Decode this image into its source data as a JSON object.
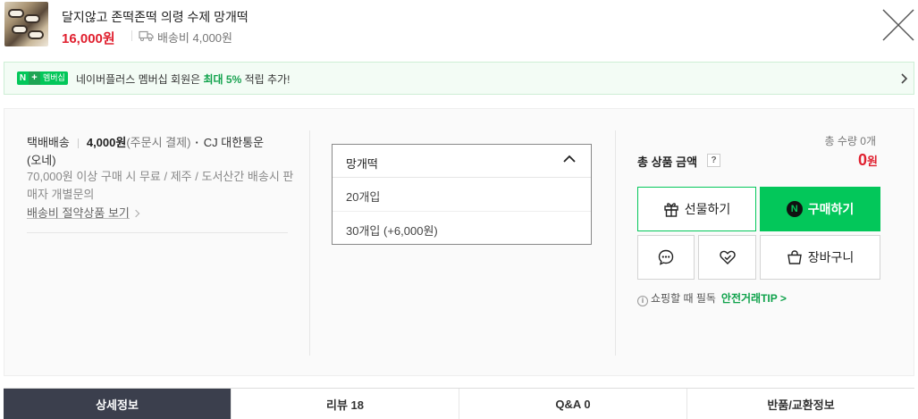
{
  "product": {
    "title": "달지않고 존떡존떡 의령 수제 망개떡",
    "price": "16,000원",
    "shipping_fee": "배송비 4,000원"
  },
  "banner": {
    "badge_n": "N",
    "badge_plus": "+",
    "badge_label": "멤버십",
    "text_prefix": "네이버플러스 멤버십 회원은 ",
    "text_highlight": "최대",
    "text_rate": "5%",
    "text_suffix": " 적립 추가!"
  },
  "shipping": {
    "method": "택배배송",
    "fee": "4,000원",
    "fee_condition": "(주문시 결제)",
    "carrier": "CJ 대한통운",
    "carrier_note": "(오네)",
    "note": "70,000원 이상 구매 시 무료 / 제주 / 도서산간 배송시 판매자 개별문의",
    "save_link": "배송비 절약상품 보기"
  },
  "option": {
    "selected": "망개떡",
    "options": [
      "20개입",
      "30개입 (+6,000원)"
    ]
  },
  "summary": {
    "total_qty": "총 수량 0개",
    "total_label": "총 상품 금액",
    "help_icon": "?",
    "total_price": "0",
    "total_unit": "원"
  },
  "buttons": {
    "gift": "선물하기",
    "buy": "구매하기",
    "buy_badge": "N",
    "cart": "장바구니"
  },
  "safe_trade": {
    "info_icon": "i",
    "text": "쇼핑할 때 필독",
    "tip": "안전거래TIP >"
  },
  "tabs": [
    {
      "label": "상세정보"
    },
    {
      "label": "리뷰 18"
    },
    {
      "label": "Q&A 0"
    },
    {
      "label": "반품/교환정보"
    }
  ],
  "icons": {
    "close": "close-icon",
    "truck": "truck-icon",
    "gift": "gift-icon",
    "talk": "chat-icon",
    "zzim": "heart-icon",
    "cart": "cart-icon"
  },
  "colors": {
    "accent_green": "#03c75a",
    "price_red": "#e0202f",
    "tab_active": "#3b3f4d"
  }
}
